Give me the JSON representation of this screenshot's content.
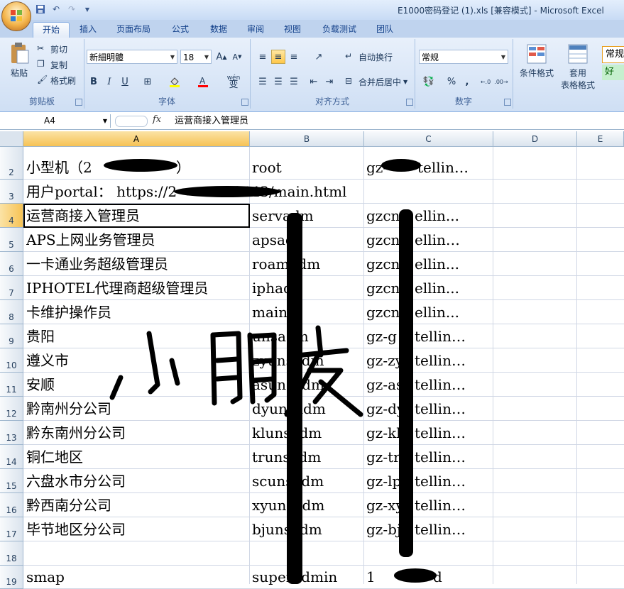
{
  "window": {
    "title": "E1000密码登记 (1).xls  [兼容模式] - Microsoft Excel"
  },
  "ribbon_tabs": [
    "开始",
    "插入",
    "页面布局",
    "公式",
    "数据",
    "审阅",
    "视图",
    "负载测试",
    "团队"
  ],
  "clipboard": {
    "paste": "粘贴",
    "cut": "剪切",
    "copy": "复制",
    "format_painter": "格式刷",
    "label": "剪贴板"
  },
  "font": {
    "name": "新細明體",
    "size": "18",
    "label": "字体",
    "wen": "wén",
    "wen_char": "变"
  },
  "alignment": {
    "wrap": "自动换行",
    "merge": "合并后居中",
    "label": "对齐方式"
  },
  "number": {
    "format": "常规",
    "percent": "%",
    "comma": ",",
    "label": "数字"
  },
  "styles": {
    "conditional": "条件格式",
    "table_line1": "套用",
    "table_line2": "表格格式",
    "style_normal": "常规",
    "style_good": "好"
  },
  "formula_bar": {
    "name_box": "A4",
    "fx": "fx",
    "content": "运营商接入管理员"
  },
  "columns": [
    "A",
    "B",
    "C",
    "D",
    "E"
  ],
  "rows": [
    {
      "num": "2",
      "a": "小型机（2",
      "a2": "）",
      "b": "root",
      "c": "gz-",
      "c2": "tellin…"
    },
    {
      "num": "3",
      "a": "用户portal： https://2",
      "a2": "8443/main.html",
      "b": "",
      "c": "",
      "c2": ""
    },
    {
      "num": "4",
      "a": "运营商接入管理员",
      "b": "servadm",
      "c": "gzcn",
      "c2": "ellin..."
    },
    {
      "num": "5",
      "a": "APS上网业务管理员",
      "b": "apsad",
      "c": "gzcn",
      "c2": "ellin…"
    },
    {
      "num": "6",
      "a": "一卡通业务超级管理员",
      "b": "roamadm",
      "c": "gzcn",
      "c2": "ellin..."
    },
    {
      "num": "7",
      "a": "IPHOTEL代理商超级管理员",
      "b": "iphad",
      "c": "gzcn",
      "c2": "ellin..."
    },
    {
      "num": "8",
      "a": "卡维护操作员",
      "b": "maintr",
      "c": "gzcn",
      "c2": "ellin..."
    },
    {
      "num": "9",
      "a": "贵阳",
      "b": "unsadm",
      "c": "gz-g",
      "c2": "tellin…"
    },
    {
      "num": "10",
      "a": "遵义市",
      "b": "zyunsadm",
      "c": "gz-zy",
      "c2": "tellin…"
    },
    {
      "num": "11",
      "a": "安顺",
      "b": "asunsadm",
      "c": "gz-as",
      "c2": "tellin…"
    },
    {
      "num": "12",
      "a": "黔南州分公司",
      "b": "dyunsadm",
      "c": "gz-dy",
      "c2": "tellin…"
    },
    {
      "num": "13",
      "a": "黔东南州分公司",
      "b": "klunsadm",
      "c": "gz-kl",
      "c2": "tellin…"
    },
    {
      "num": "14",
      "a": "铜仁地区",
      "b": "trunsadm",
      "c": "gz-tr",
      "c2": "tellin…"
    },
    {
      "num": "15",
      "a": "六盘水市分公司",
      "b": "scunsadm",
      "c": "gz-lp",
      "c2": "tellin…"
    },
    {
      "num": "16",
      "a": "黔西南分公司",
      "b": "xyunsadm",
      "c": "gz-xy",
      "c2": "tellin…"
    },
    {
      "num": "17",
      "a": "毕节地区分公司",
      "b": "bjunsadm",
      "c": "gz-bj",
      "c2": "tellin…"
    },
    {
      "num": "18",
      "a": "",
      "b": "",
      "c": "",
      "c2": ""
    },
    {
      "num": "19",
      "a": "smap",
      "b": "superadmin",
      "c": "1",
      "c2": "d"
    }
  ]
}
